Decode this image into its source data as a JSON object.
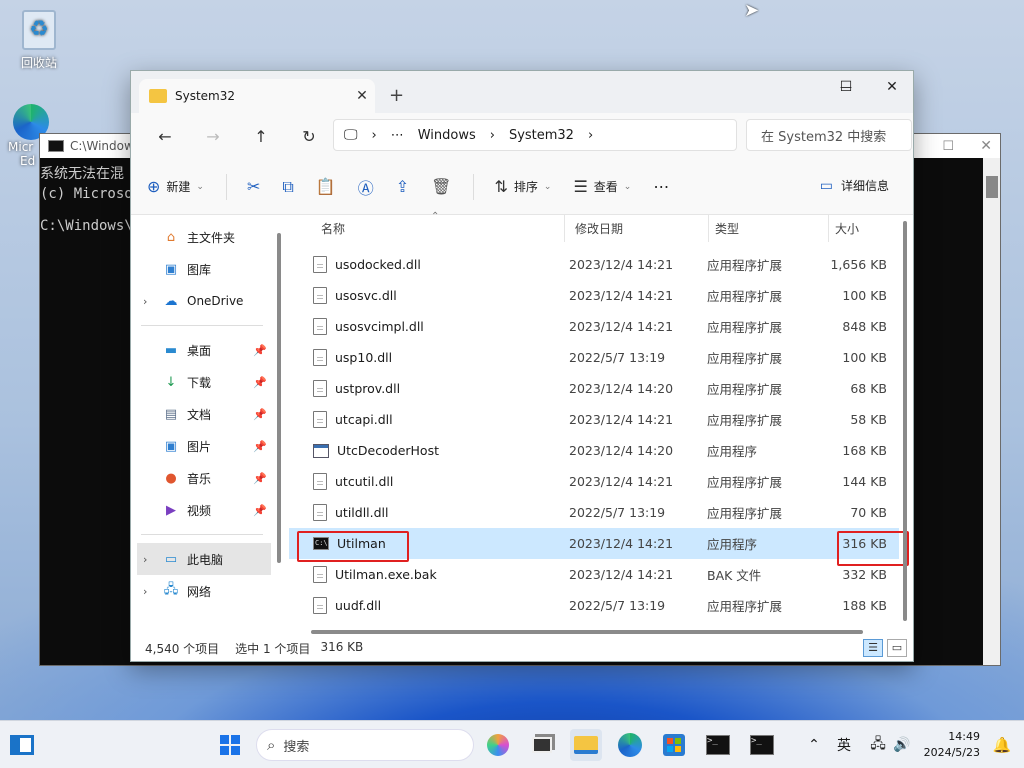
{
  "desktop": {
    "recycle_label": "回收站",
    "edge_label_1": "Micr",
    "edge_label_2": "Ed"
  },
  "cmd_window": {
    "title": "C:\\Windows",
    "lines": [
      "系统无法在混",
      "(c) Microso",
      "C:\\Windows\\S"
    ]
  },
  "explorer": {
    "tab_title": "System32",
    "tab_close": "✕",
    "new_tab": "+",
    "window_controls": {
      "minimize": "—",
      "maximize": "☐",
      "close": "✕"
    },
    "address": [
      "⋯",
      "Windows",
      "System32"
    ],
    "search_placeholder": "在 System32 中搜索",
    "toolbar": {
      "new_label": "新建",
      "sort_label": "排序",
      "view_label": "查看",
      "more_label": "⋯",
      "details_label": "详细信息"
    },
    "nav": {
      "home": "主文件夹",
      "gallery": "图库",
      "onedrive": "OneDrive",
      "desktop": "桌面",
      "downloads": "下载",
      "documents": "文档",
      "pictures": "图片",
      "music": "音乐",
      "videos": "视频",
      "this_pc": "此电脑",
      "network": "网络"
    },
    "columns": {
      "name": "名称",
      "date": "修改日期",
      "type": "类型",
      "size": "大小"
    },
    "files": [
      {
        "name": "usodocked.dll",
        "date": "2023/12/4 14:21",
        "type": "应用程序扩展",
        "size": "1,656 KB",
        "icon": "dll"
      },
      {
        "name": "usosvc.dll",
        "date": "2023/12/4 14:21",
        "type": "应用程序扩展",
        "size": "100 KB",
        "icon": "dll"
      },
      {
        "name": "usosvcimpl.dll",
        "date": "2023/12/4 14:21",
        "type": "应用程序扩展",
        "size": "848 KB",
        "icon": "dll"
      },
      {
        "name": "usp10.dll",
        "date": "2022/5/7 13:19",
        "type": "应用程序扩展",
        "size": "100 KB",
        "icon": "dll"
      },
      {
        "name": "ustprov.dll",
        "date": "2023/12/4 14:20",
        "type": "应用程序扩展",
        "size": "68 KB",
        "icon": "dll"
      },
      {
        "name": "utcapi.dll",
        "date": "2023/12/4 14:21",
        "type": "应用程序扩展",
        "size": "58 KB",
        "icon": "dll"
      },
      {
        "name": "UtcDecoderHost",
        "date": "2023/12/4 14:20",
        "type": "应用程序",
        "size": "168 KB",
        "icon": "exe"
      },
      {
        "name": "utcutil.dll",
        "date": "2023/12/4 14:21",
        "type": "应用程序扩展",
        "size": "144 KB",
        "icon": "dll"
      },
      {
        "name": "utildll.dll",
        "date": "2022/5/7 13:19",
        "type": "应用程序扩展",
        "size": "70 KB",
        "icon": "dll"
      },
      {
        "name": "Utilman",
        "date": "2023/12/4 14:21",
        "type": "应用程序",
        "size": "316 KB",
        "icon": "cmd"
      },
      {
        "name": "Utilman.exe.bak",
        "date": "2023/12/4 14:21",
        "type": "BAK 文件",
        "size": "332 KB",
        "icon": "dll"
      },
      {
        "name": "uudf.dll",
        "date": "2022/5/7 13:19",
        "type": "应用程序扩展",
        "size": "188 KB",
        "icon": "dll"
      }
    ],
    "status": {
      "count": "4,540 个项目",
      "selected": "选中 1 个项目",
      "selected_size": "316 KB"
    }
  },
  "taskbar": {
    "search_label": "搜索",
    "ime": "英",
    "time": "14:49",
    "date": "2024/5/23"
  },
  "colors": {
    "selection": "#cce8ff",
    "highlight_box": "#e02020",
    "accent": "#1f5fbf"
  }
}
